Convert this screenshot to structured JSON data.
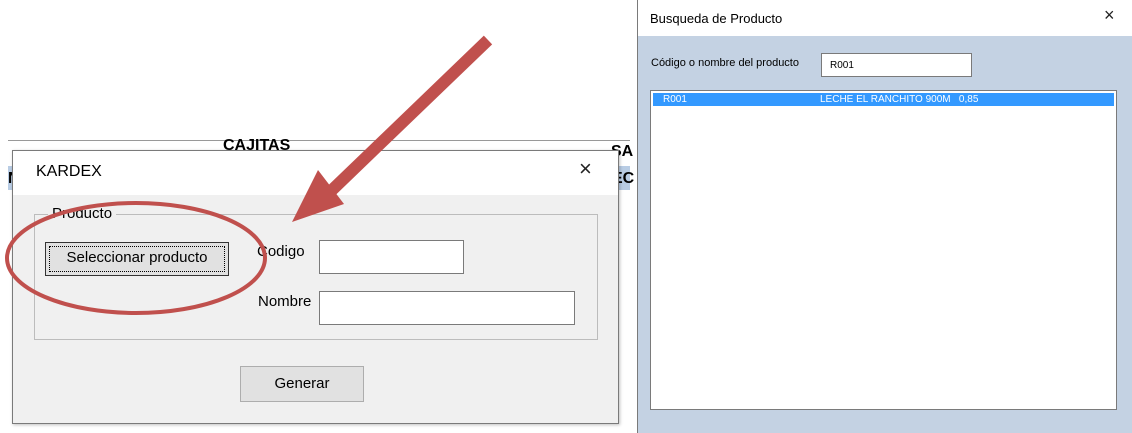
{
  "background_sheet": {
    "fragments": [
      "CAJITAS",
      "SA",
      "N",
      "EC"
    ]
  },
  "kardex_dialog": {
    "title": "KARDEX",
    "close_glyph": "×",
    "group_label": "Producto",
    "select_button_label": "Seleccionar producto",
    "codigo_label": "Codigo",
    "codigo_value": "",
    "nombre_label": "Nombre",
    "nombre_value": "",
    "generate_button_label": "Generar"
  },
  "busqueda_dialog": {
    "title": "Busqueda de Producto",
    "close_glyph": "×",
    "search_label": "Código o nombre del producto",
    "search_value": "R001",
    "results": [
      {
        "code": "R001",
        "description": "LECHE EL RANCHITO 900M   0,85",
        "selected": true
      }
    ]
  },
  "annotations": {
    "arrow_color": "#c0504d",
    "circle_color": "#c0504d"
  },
  "colors": {
    "selection": "#3399ff",
    "busqueda_body": "#c4d2e3",
    "sheet_header": "#b8cce4"
  }
}
